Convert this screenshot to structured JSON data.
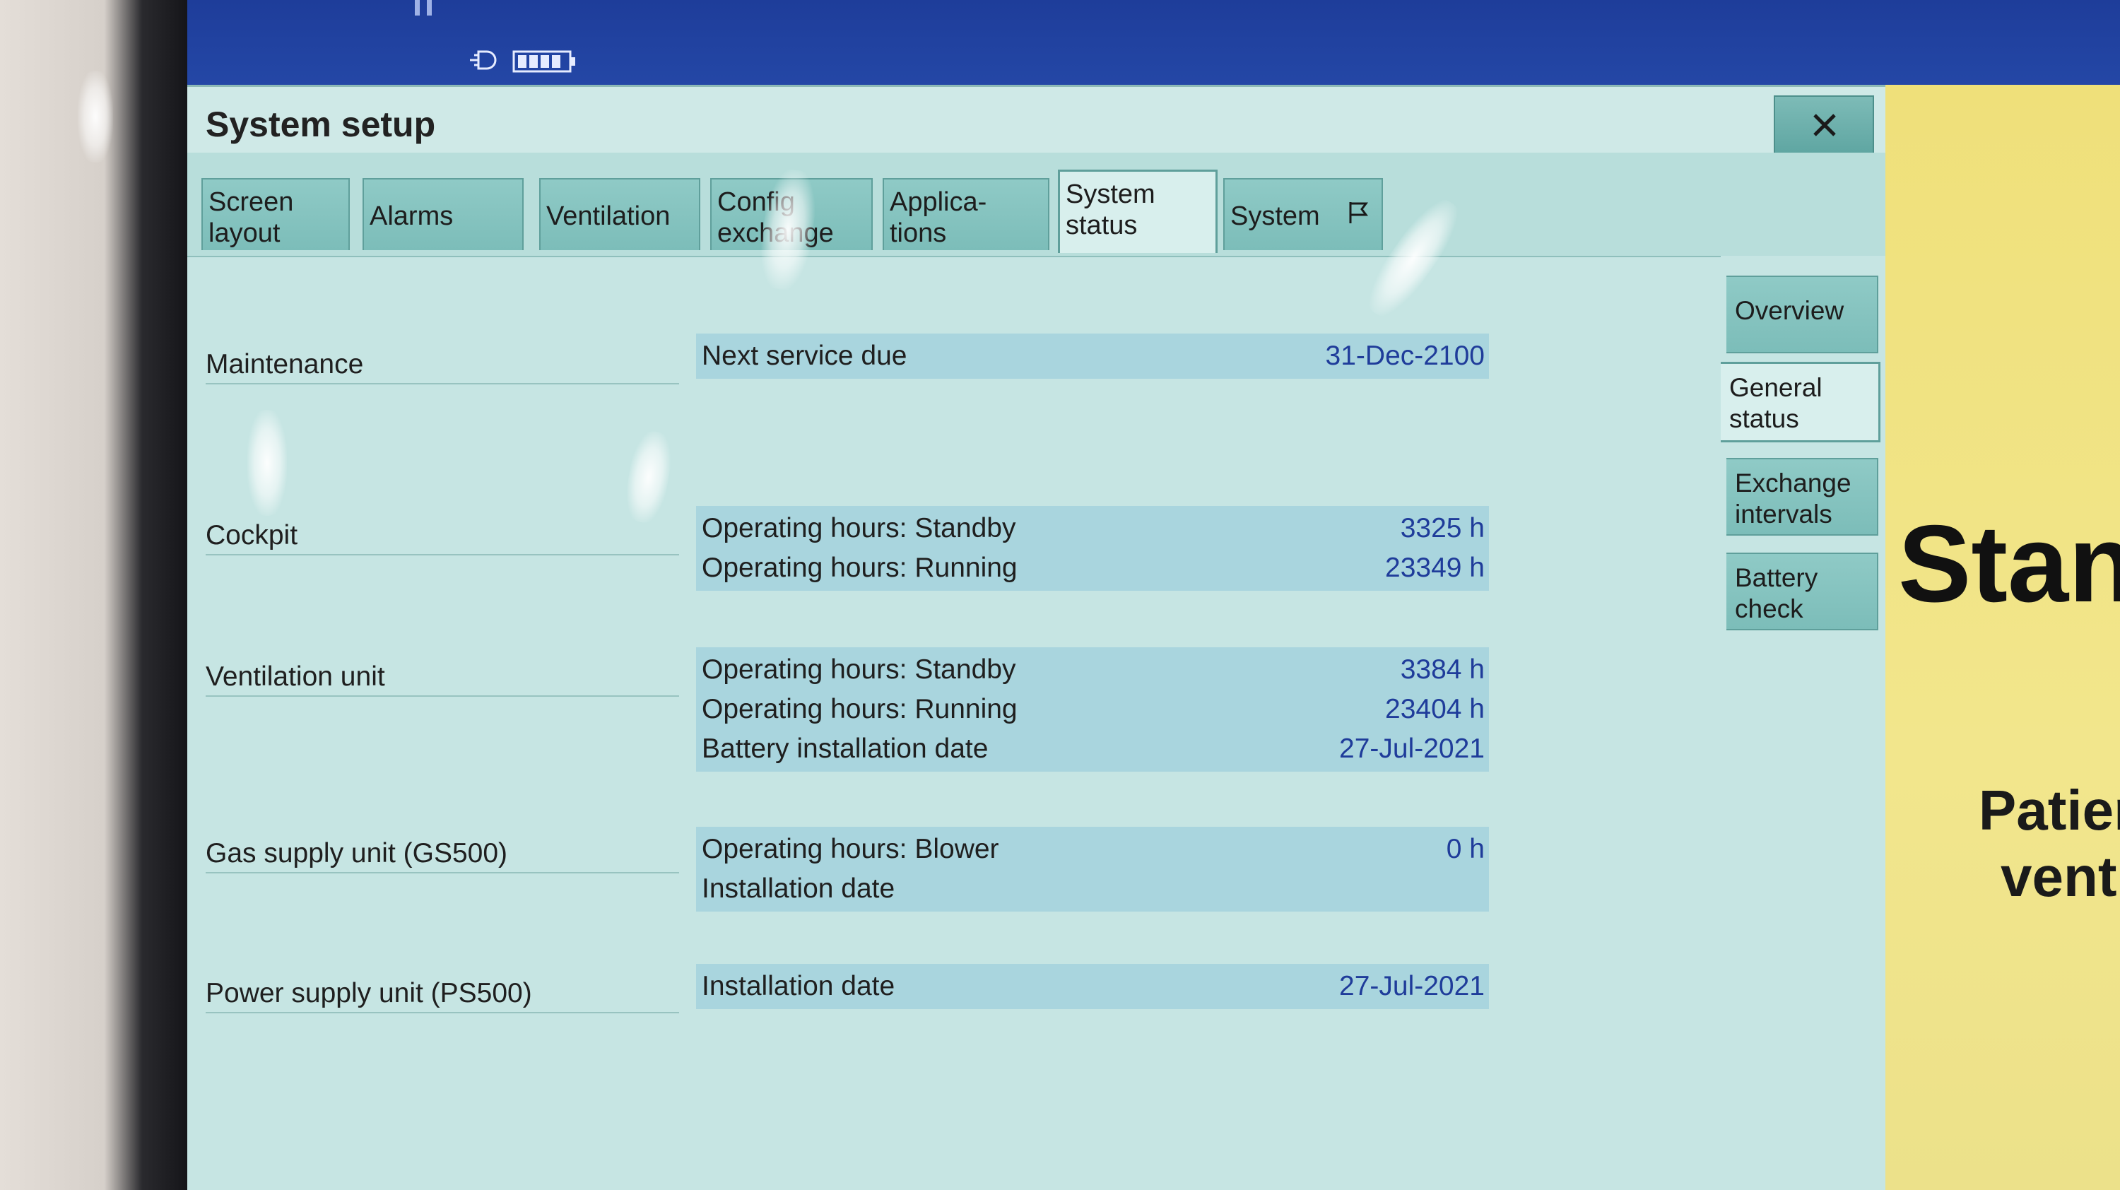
{
  "colors": {
    "top_bar": "#2447a6",
    "dialog_bg": "#c6e5e3",
    "tab_bg": "#7cbdb9",
    "value_row_bg": "#a9d5de",
    "value_text": "#1f3c9a",
    "standby_panel": "#f2e68c"
  },
  "status_bar": {
    "icons": [
      "pause-icon",
      "mains-plug-icon",
      "battery-icon"
    ]
  },
  "dialog": {
    "title": "System setup",
    "close_icon": "close-x-icon"
  },
  "tabs": [
    {
      "line1": "Screen",
      "line2": "layout"
    },
    {
      "line1": "Alarms",
      "line2": ""
    },
    {
      "line1": "Ventilation",
      "line2": ""
    },
    {
      "line1": "Config",
      "line2": "exchange"
    },
    {
      "line1": "Applica-",
      "line2": "tions"
    },
    {
      "line1": "System",
      "line2": "status",
      "active": true
    },
    {
      "line1": "System",
      "line2": "",
      "icon": "flag-icon"
    }
  ],
  "side_tabs": [
    {
      "line1": "Overview",
      "line2": ""
    },
    {
      "line1": "General",
      "line2": "status",
      "active": true
    },
    {
      "line1": "Exchange",
      "line2": "intervals"
    },
    {
      "line1": "Battery",
      "line2": "check"
    }
  ],
  "sections": [
    {
      "label": "Maintenance",
      "rows": [
        {
          "key": "Next service due",
          "value": "31-Dec-2100"
        }
      ]
    },
    {
      "label": "Cockpit",
      "rows": [
        {
          "key": "Operating hours: Standby",
          "value": "3325 h"
        },
        {
          "key": "Operating hours: Running",
          "value": "23349 h"
        }
      ]
    },
    {
      "label": "Ventilation unit",
      "rows": [
        {
          "key": "Operating hours: Standby",
          "value": "3384 h"
        },
        {
          "key": "Operating hours: Running",
          "value": "23404 h"
        },
        {
          "key": "Battery installation date",
          "value": "27-Jul-2021"
        }
      ]
    },
    {
      "label": "Gas supply unit (GS500)",
      "rows": [
        {
          "key": "Operating hours: Blower",
          "value": "0 h"
        },
        {
          "key": "Installation date",
          "value": ""
        }
      ]
    },
    {
      "label": "Power supply unit (PS500)",
      "rows": [
        {
          "key": "Installation date",
          "value": "27-Jul-2021"
        }
      ]
    }
  ],
  "standby_panel": {
    "title": "Stan",
    "subtitle": "Patien\nventil"
  }
}
